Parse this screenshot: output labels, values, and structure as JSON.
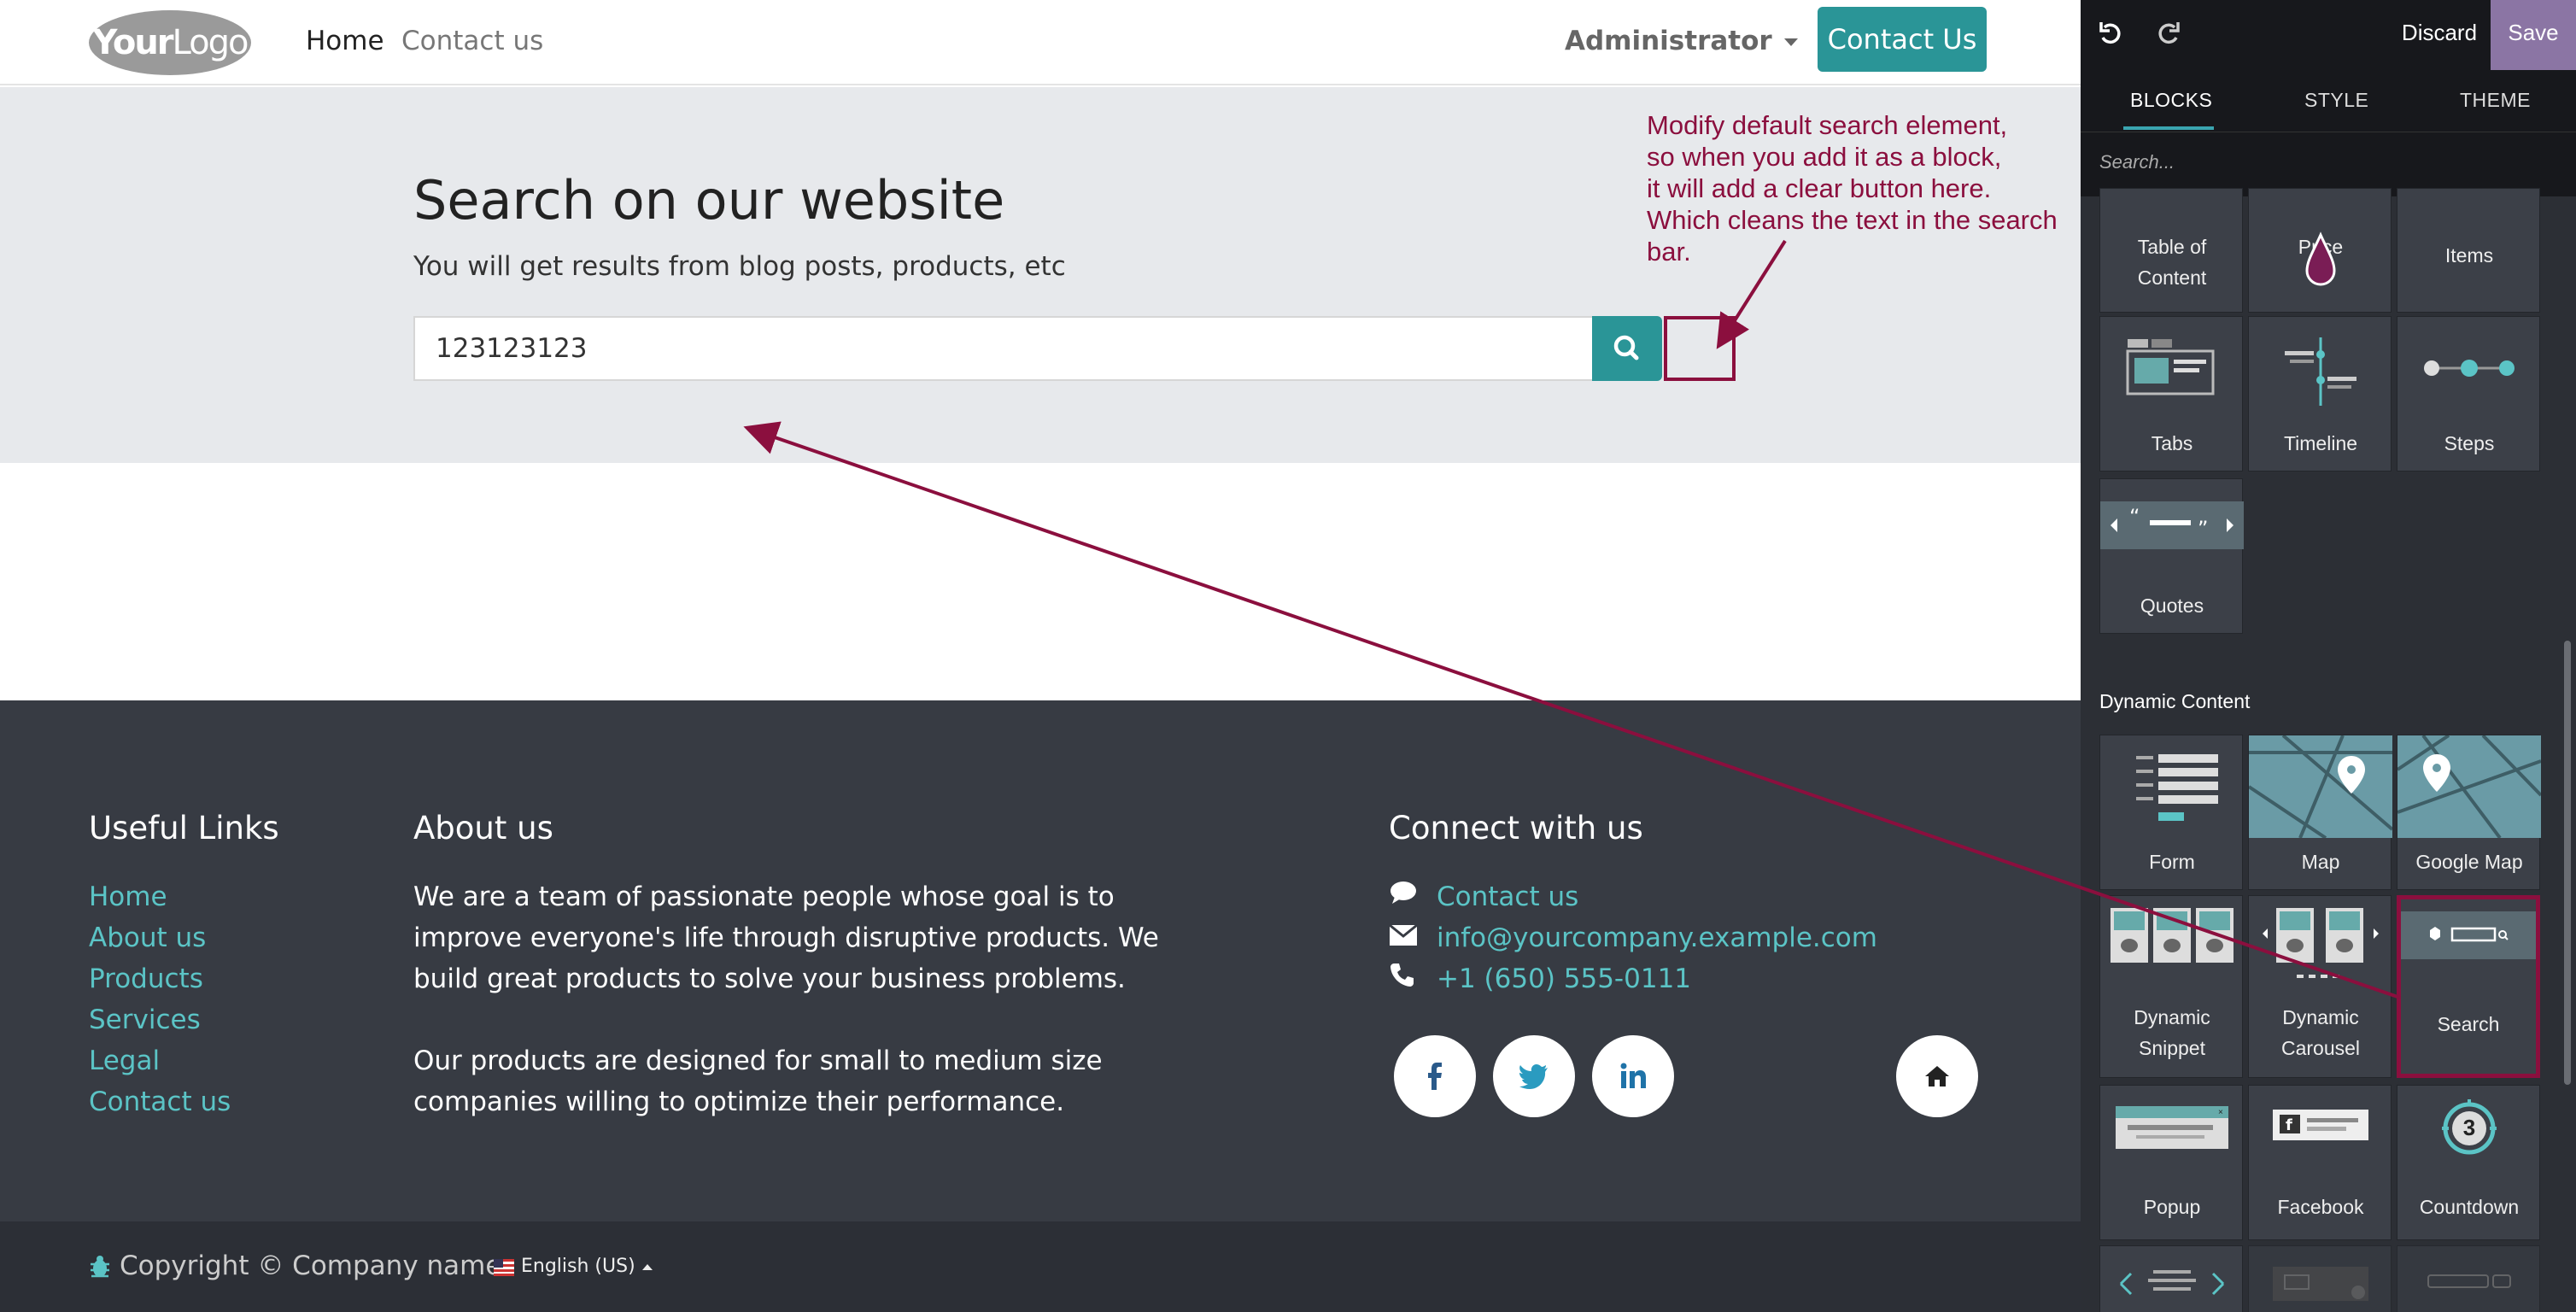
{
  "navbar": {
    "logo_bold": "Your",
    "logo_light": "Logo",
    "links": [
      "Home",
      "Contact us"
    ],
    "user": "Administrator",
    "cta": "Contact Us"
  },
  "search_section": {
    "title": "Search on our website",
    "subtitle": "You will get results from blog posts, products, etc",
    "input_value": "123123123"
  },
  "footer": {
    "useful_links_title": "Useful Links",
    "useful_links": [
      "Home",
      "About us",
      "Products",
      "Services",
      "Legal",
      "Contact us"
    ],
    "about_title": "About us",
    "about_p1": "We are a team of passionate people whose goal is to improve everyone's life through disruptive products. We build great products to solve your business problems.",
    "about_p2": "Our products are designed for small to medium size companies willing to optimize their performance.",
    "connect_title": "Connect with us",
    "connect": [
      {
        "icon": "chat-icon",
        "text": "Contact us"
      },
      {
        "icon": "envelope-icon",
        "text": "info@yourcompany.example.com"
      },
      {
        "icon": "phone-icon",
        "text": "+1 (650) 555-0111"
      }
    ],
    "socials": [
      "facebook-icon",
      "twitter-icon",
      "linkedin-icon",
      "home-icon"
    ],
    "copyright": "Copyright © Company name",
    "language": "English (US)"
  },
  "annotation": {
    "text": "Modify default search element,\nso when you add it as a block,\nit will add a clear button here.\nWhich cleans the text in the search\nbar.",
    "color": "#8b0f3e"
  },
  "editor": {
    "discard": "Discard",
    "save": "Save",
    "tabs": [
      "BLOCKS",
      "STYLE",
      "THEME"
    ],
    "search_placeholder": "Search...",
    "blocks_partial_row": [
      "Table of\nContent",
      "Price",
      "Items"
    ],
    "blocks_row2": [
      "Tabs",
      "Timeline",
      "Steps"
    ],
    "blocks_row3": [
      "Quotes"
    ],
    "category_dynamic": "Dynamic Content",
    "dynamic_row1": [
      "Form",
      "Map",
      "Google Map"
    ],
    "dynamic_row2": [
      "Dynamic\nSnippet",
      "Dynamic\nCarousel",
      "Search"
    ],
    "dynamic_row3": [
      "Popup",
      "Facebook",
      "Countdown"
    ],
    "countdown_number": "3"
  },
  "colors": {
    "teal": "#2a9597",
    "link": "#5bc4c6",
    "footer_bg": "#373b43",
    "save_purple": "#8b75a4",
    "annotation": "#8b0f3e"
  }
}
